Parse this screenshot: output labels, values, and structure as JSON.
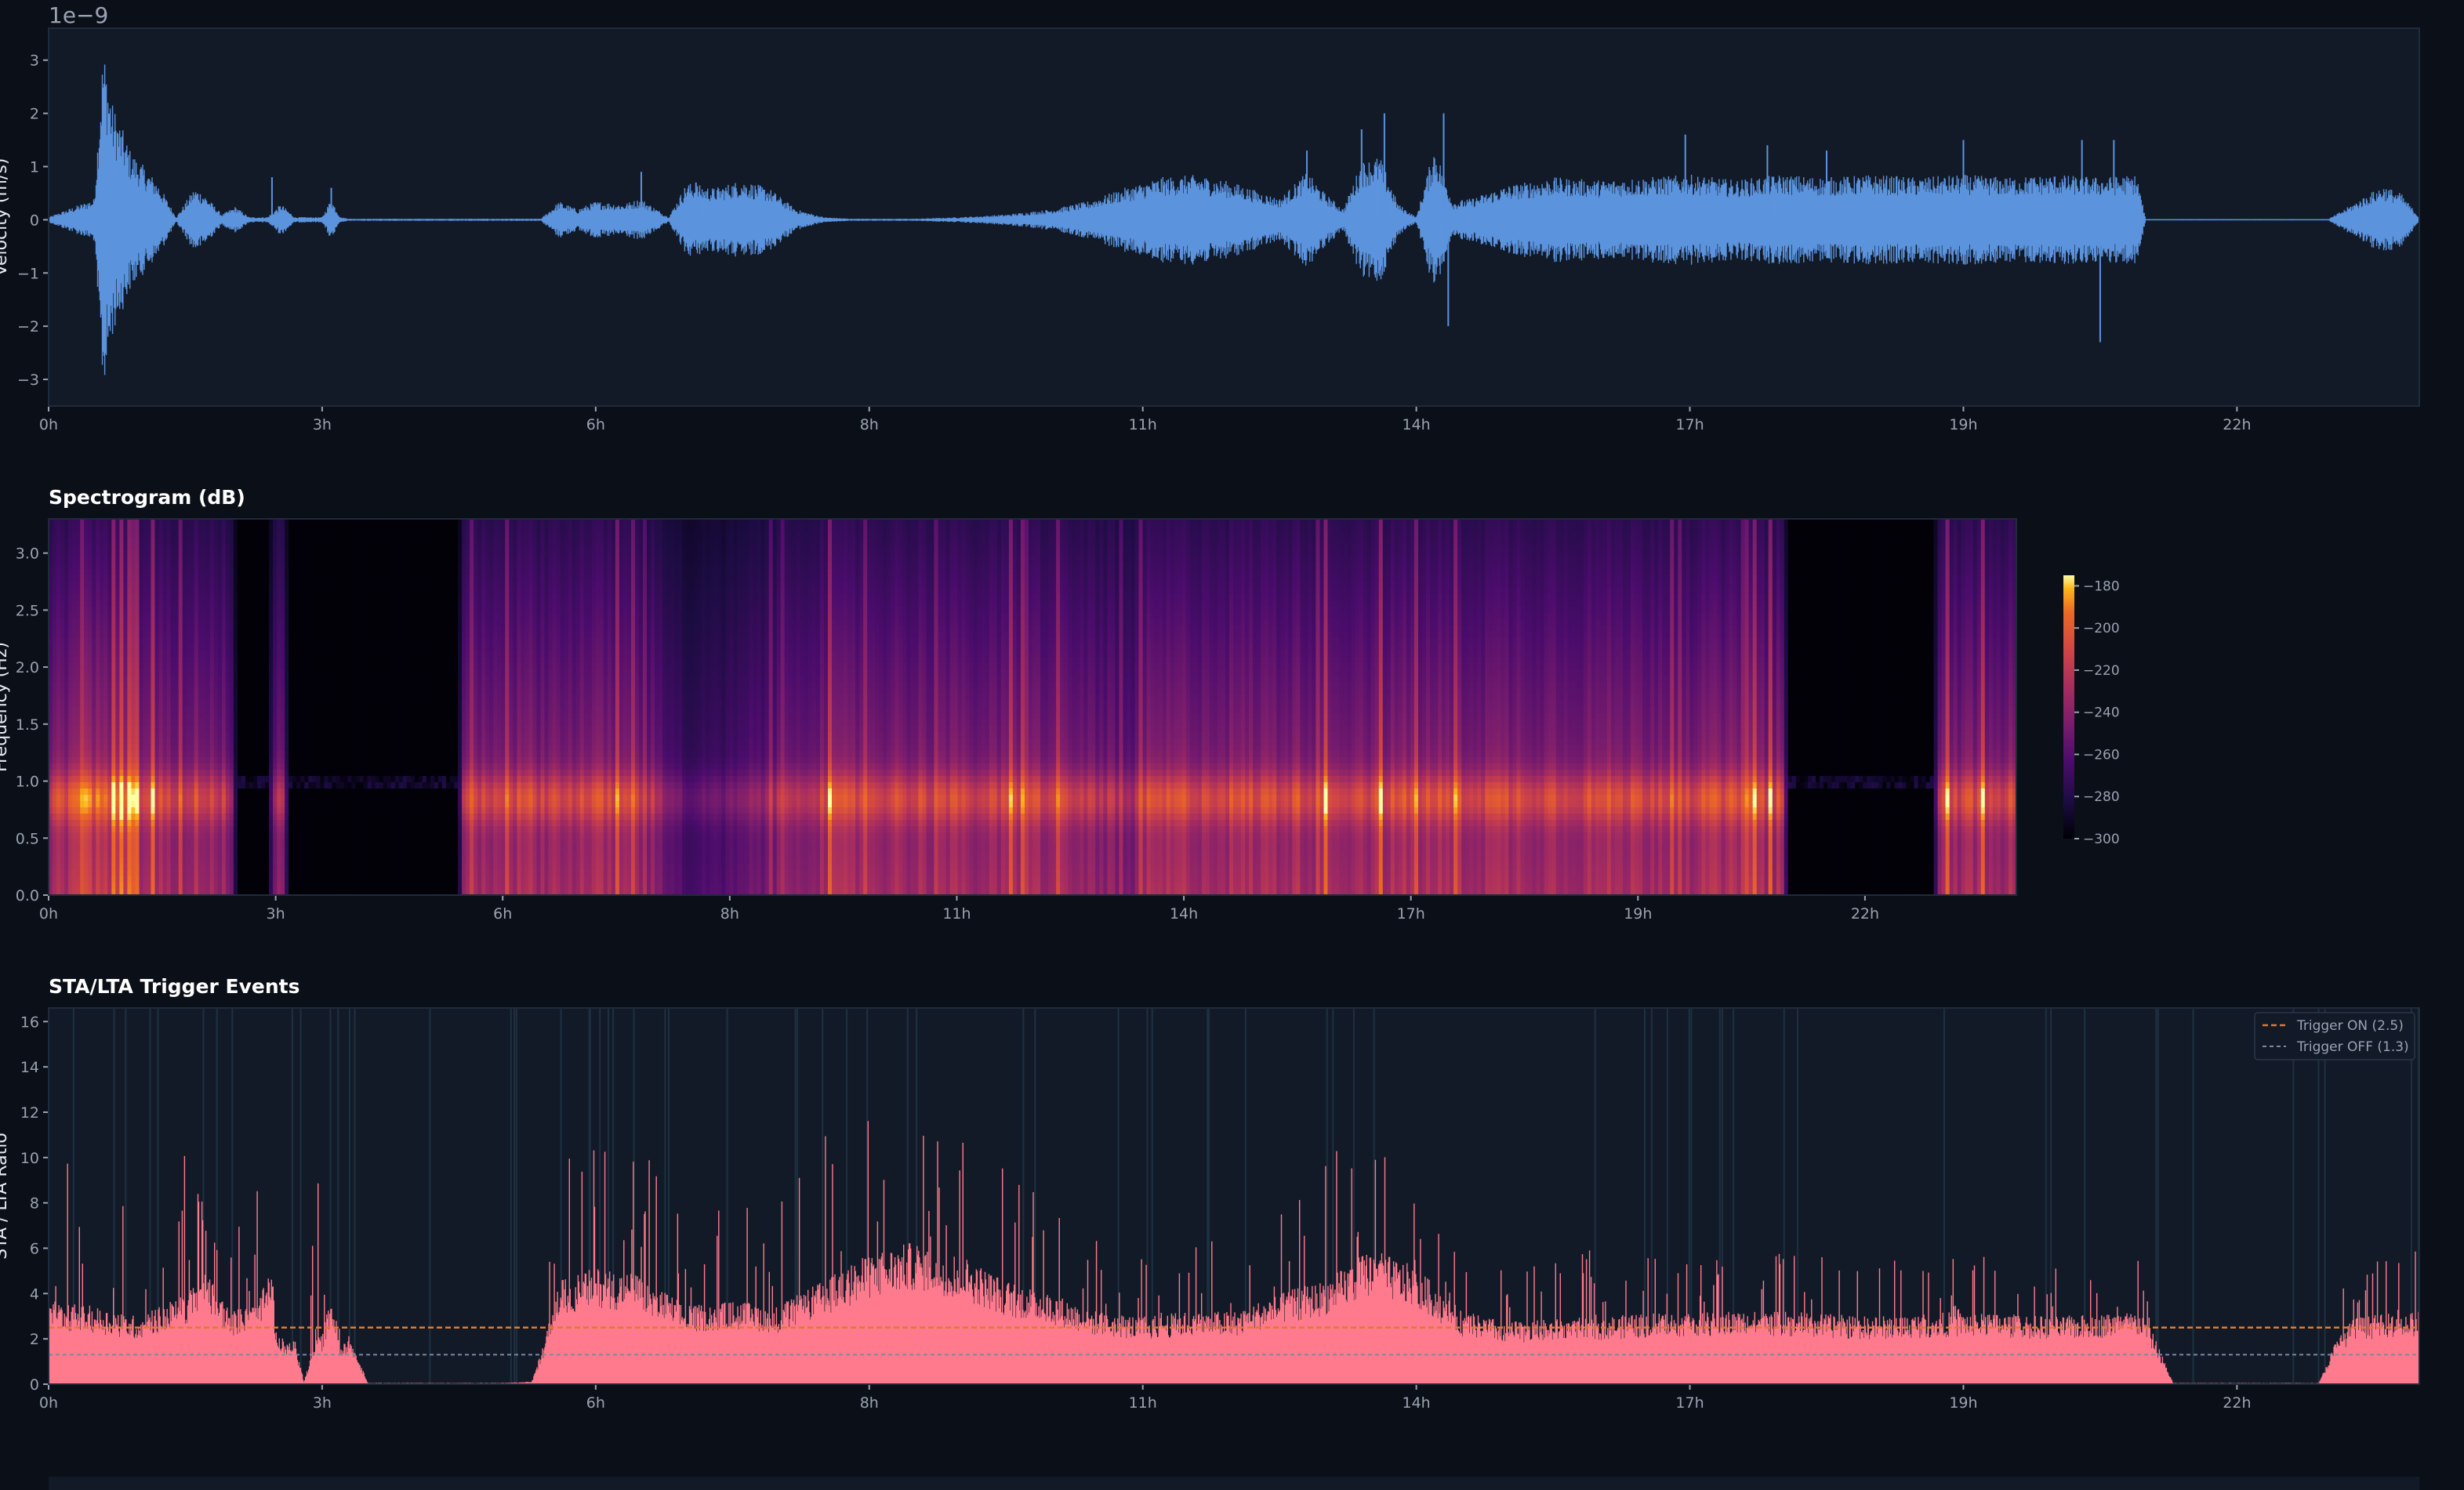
{
  "chart_data": [
    {
      "id": "waveform",
      "type": "line",
      "title": "",
      "ylabel": "Velocity (m/s)",
      "y_offset_label": "1e−9",
      "ylim": [
        -3.5,
        3.6
      ],
      "xlim": [
        0,
        26
      ],
      "x_ticks": [
        {
          "value": 0,
          "label": "0h"
        },
        {
          "value": 3,
          "label": "3h"
        },
        {
          "value": 6,
          "label": "6h"
        },
        {
          "value": 9,
          "label": "8h"
        },
        {
          "value": 12,
          "label": "11h"
        },
        {
          "value": 15,
          "label": "14h"
        },
        {
          "value": 18,
          "label": "17h"
        },
        {
          "value": 21,
          "label": "19h"
        },
        {
          "value": 24,
          "label": "22h"
        }
      ],
      "y_ticks": [
        {
          "value": 3,
          "label": "3"
        },
        {
          "value": 2,
          "label": "2"
        },
        {
          "value": 1,
          "label": "1"
        },
        {
          "value": 0,
          "label": "0"
        },
        {
          "value": -1,
          "label": "−1"
        },
        {
          "value": -2,
          "label": "−2"
        },
        {
          "value": -3,
          "label": "−3"
        }
      ],
      "color": "#5b93dd",
      "series": [
        {
          "x": [
            0,
            0.5,
            0.6,
            0.7,
            0.9,
            1.2,
            1.4,
            1.6,
            1.7,
            1.9,
            2.05,
            2.2,
            2.4,
            2.55,
            2.7,
            3.0,
            3.1,
            3.2,
            3.3,
            4.0,
            5.4,
            5.6,
            5.8,
            6.0,
            6.3,
            6.5,
            6.8,
            7.0,
            7.3,
            7.6,
            7.9,
            8.2,
            8.5,
            8.8,
            9.0,
            9.5,
            10.0,
            10.5,
            11.0,
            11.4,
            11.8,
            12.2,
            12.6,
            13.0,
            13.5,
            13.8,
            14.0,
            14.2,
            14.4,
            14.6,
            14.8,
            15.0,
            15.2,
            15.4,
            15.6,
            16.0,
            16.5,
            17.0,
            17.5,
            18.0,
            18.5,
            19.0,
            19.5,
            20.0,
            20.5,
            21.0,
            21.5,
            22.0,
            22.5,
            22.9,
            23.0,
            23.5,
            24.0,
            25.0,
            25.6,
            25.8,
            26.0
          ],
          "amp": [
            0.05,
            0.4,
            3.3,
            2.2,
            1.3,
            0.7,
            0.05,
            0.6,
            0.5,
            0.1,
            0.25,
            0.05,
            0.05,
            0.3,
            0.05,
            0.05,
            0.4,
            0.05,
            0.02,
            0.02,
            0.02,
            0.35,
            0.2,
            0.35,
            0.3,
            0.4,
            0.05,
            0.7,
            0.6,
            0.75,
            0.6,
            0.2,
            0.05,
            0.02,
            0.02,
            0.02,
            0.05,
            0.1,
            0.2,
            0.35,
            0.6,
            0.8,
            0.85,
            0.7,
            0.4,
            0.9,
            0.5,
            0.2,
            1.1,
            1.2,
            0.3,
            0.05,
            1.4,
            0.35,
            0.4,
            0.65,
            0.8,
            0.75,
            0.8,
            0.85,
            0.75,
            0.85,
            0.8,
            0.85,
            0.8,
            0.85,
            0.8,
            0.85,
            0.8,
            0.85,
            0.01,
            0.01,
            0.01,
            0.01,
            0.65,
            0.5,
            0.05
          ],
          "spikes": [
            {
              "x": 2.45,
              "y": 0.8
            },
            {
              "x": 3.1,
              "y": 0.6
            },
            {
              "x": 6.5,
              "y": 0.9
            },
            {
              "x": 7.1,
              "y": 0.7
            },
            {
              "x": 13.8,
              "y": 1.3
            },
            {
              "x": 14.4,
              "y": 1.7
            },
            {
              "x": 14.65,
              "y": 2.0
            },
            {
              "x": 15.3,
              "y": 2.0
            },
            {
              "x": 15.35,
              "y": -2.0
            },
            {
              "x": 17.95,
              "y": 1.6
            },
            {
              "x": 18.85,
              "y": 1.4
            },
            {
              "x": 21.0,
              "y": 1.5
            },
            {
              "x": 22.3,
              "y": 1.5
            },
            {
              "x": 22.5,
              "y": -2.3
            },
            {
              "x": 22.65,
              "y": 1.5
            },
            {
              "x": 19.5,
              "y": 1.3
            }
          ]
        }
      ]
    },
    {
      "id": "spectrogram",
      "type": "heatmap",
      "title": "Spectrogram (dB)",
      "ylabel": "Frequency (Hz)",
      "ylim": [
        0,
        3.3
      ],
      "xlim": [
        0,
        26
      ],
      "x_ticks": [
        {
          "value": 0,
          "label": "0h"
        },
        {
          "value": 3,
          "label": "3h"
        },
        {
          "value": 6,
          "label": "6h"
        },
        {
          "value": 9,
          "label": "8h"
        },
        {
          "value": 12,
          "label": "11h"
        },
        {
          "value": 15,
          "label": "14h"
        },
        {
          "value": 18,
          "label": "17h"
        },
        {
          "value": 21,
          "label": "19h"
        },
        {
          "value": 24,
          "label": "22h"
        }
      ],
      "y_ticks": [
        {
          "value": 0,
          "label": "0.0"
        },
        {
          "value": 0.5,
          "label": "0.5"
        },
        {
          "value": 1.0,
          "label": "1.0"
        },
        {
          "value": 1.5,
          "label": "1.5"
        },
        {
          "value": 2.0,
          "label": "2.0"
        },
        {
          "value": 2.5,
          "label": "2.5"
        },
        {
          "value": 3.0,
          "label": "3.0"
        }
      ],
      "colorbar": {
        "range": [
          -300,
          -175
        ],
        "ticks": [
          {
            "value": -180,
            "label": "−180"
          },
          {
            "value": -200,
            "label": "−200"
          },
          {
            "value": -220,
            "label": "−220"
          },
          {
            "value": -240,
            "label": "−240"
          },
          {
            "value": -260,
            "label": "−260"
          },
          {
            "value": -280,
            "label": "−280"
          },
          {
            "value": -300,
            "label": "−300"
          }
        ],
        "colormap": "inferno"
      },
      "activity": {
        "x": [
          0,
          0.5,
          1.0,
          1.5,
          2.0,
          2.4,
          2.5,
          2.9,
          3.0,
          3.1,
          3.2,
          5.4,
          5.5,
          6.0,
          6.5,
          7.0,
          7.5,
          8.0,
          8.4,
          8.6,
          9.0,
          9.5,
          10.0,
          10.5,
          11.0,
          11.5,
          12.0,
          12.5,
          13.0,
          13.5,
          14.0,
          14.3,
          14.5,
          15.0,
          15.5,
          16.0,
          17.0,
          18.0,
          19.0,
          20.0,
          21.0,
          22.0,
          22.9,
          23.0,
          24.9,
          25.0,
          25.9,
          26.0
        ],
        "level": [
          0.75,
          0.95,
          0.85,
          0.8,
          0.8,
          0.7,
          0.02,
          0.02,
          0.7,
          0.6,
          0.02,
          0.02,
          0.75,
          0.82,
          0.8,
          0.8,
          0.8,
          0.7,
          0.4,
          0.4,
          0.45,
          0.6,
          0.75,
          0.8,
          0.8,
          0.8,
          0.78,
          0.75,
          0.8,
          0.75,
          0.7,
          0.55,
          0.8,
          0.82,
          0.82,
          0.82,
          0.82,
          0.82,
          0.82,
          0.82,
          0.82,
          0.82,
          0.8,
          0.02,
          0.02,
          0.8,
          0.8,
          0.8
        ]
      }
    },
    {
      "id": "sta-lta",
      "type": "area",
      "title": "STA/LTA Trigger Events",
      "ylabel": "STA / LTA Ratio",
      "ylim": [
        0,
        16.6
      ],
      "xlim": [
        0,
        26
      ],
      "x_ticks": [
        {
          "value": 0,
          "label": "0h"
        },
        {
          "value": 3,
          "label": "3h"
        },
        {
          "value": 6,
          "label": "6h"
        },
        {
          "value": 9,
          "label": "8h"
        },
        {
          "value": 12,
          "label": "11h"
        },
        {
          "value": 15,
          "label": "14h"
        },
        {
          "value": 18,
          "label": "17h"
        },
        {
          "value": 21,
          "label": "19h"
        },
        {
          "value": 24,
          "label": "22h"
        }
      ],
      "y_ticks": [
        {
          "value": 0,
          "label": "0"
        },
        {
          "value": 2,
          "label": "2"
        },
        {
          "value": 4,
          "label": "4"
        },
        {
          "value": 6,
          "label": "6"
        },
        {
          "value": 8,
          "label": "8"
        },
        {
          "value": 10,
          "label": "10"
        },
        {
          "value": 12,
          "label": "12"
        },
        {
          "value": 14,
          "label": "14"
        },
        {
          "value": 16,
          "label": "16"
        }
      ],
      "color": "#ff7a8c",
      "legend": [
        {
          "name": "Trigger ON (2.5)",
          "value": 2.5,
          "color": "#e07a2c",
          "style": "dashed"
        },
        {
          "name": "Trigger OFF (1.3)",
          "value": 1.3,
          "color": "#7b8aa0",
          "style": "dashed"
        }
      ],
      "legend_position": "top-right",
      "series": [
        {
          "x": [
            0,
            0.5,
            1.0,
            1.5,
            1.7,
            2.0,
            2.3,
            2.45,
            2.5,
            2.7,
            2.8,
            2.95,
            3.0,
            3.1,
            3.2,
            3.3,
            3.5,
            4.0,
            5.0,
            5.3,
            5.45,
            5.6,
            6.0,
            6.5,
            7.0,
            7.5,
            8.0,
            8.5,
            9.0,
            9.5,
            10.0,
            10.5,
            11.0,
            11.5,
            12.0,
            12.5,
            13.0,
            13.5,
            14.0,
            14.5,
            15.0,
            15.5,
            16.0,
            17.0,
            18.0,
            19.0,
            20.0,
            21.0,
            22.0,
            22.95,
            23.1,
            23.3,
            24.0,
            24.9,
            25.1,
            25.3,
            26.0
          ],
          "base": [
            3.2,
            3.0,
            2.6,
            3.5,
            4.5,
            2.8,
            3.2,
            4.5,
            1.8,
            1.7,
            0.1,
            1.9,
            1.9,
            3.5,
            1.6,
            1.9,
            0.05,
            0.05,
            0.05,
            0.1,
            1.8,
            4.0,
            4.5,
            4.2,
            3.0,
            3.2,
            3.0,
            4.0,
            5.0,
            5.5,
            5.0,
            4.0,
            3.5,
            2.8,
            2.6,
            2.8,
            2.8,
            3.5,
            4.0,
            5.2,
            4.5,
            2.8,
            2.4,
            2.6,
            2.8,
            2.8,
            2.6,
            2.8,
            2.6,
            2.8,
            1.8,
            0.05,
            0.05,
            0.05,
            1.8,
            2.6,
            2.8
          ],
          "peak": [
            11.8,
            9.5,
            7.5,
            11.0,
            8.0,
            6.0,
            12.5,
            12.0,
            1.8,
            1.7,
            0.1,
            12.0,
            1.9,
            11.8,
            1.6,
            1.9,
            0.05,
            0.05,
            0.05,
            0.1,
            12.3,
            9.5,
            11.5,
            10.5,
            8.0,
            8.0,
            8.5,
            11.0,
            12.5,
            13.0,
            12.0,
            9.5,
            8.0,
            6.5,
            6.0,
            6.5,
            7.0,
            8.0,
            10.0,
            11.5,
            8.0,
            5.5,
            5.0,
            6.0,
            5.5,
            6.0,
            5.5,
            6.0,
            5.5,
            5.8,
            1.8,
            0.05,
            0.05,
            0.05,
            5.8,
            5.5,
            6.0
          ]
        }
      ]
    }
  ]
}
